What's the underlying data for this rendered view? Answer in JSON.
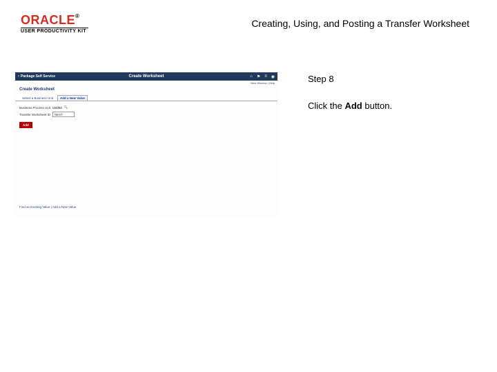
{
  "header": {
    "brand_name": "ORACLE",
    "brand_tm": "®",
    "upk_label": "USER PRODUCTIVITY KIT",
    "doc_title": "Creating, Using, and Posting a Transfer Worksheet"
  },
  "instructions": {
    "step_label": "Step 8",
    "pre_text": "Click the ",
    "bold_text": "Add",
    "post_text": " button."
  },
  "screenshot": {
    "topbar": {
      "back_glyph": "‹",
      "section_title": "Package Self Service",
      "page_title": "Create Worksheet",
      "icons": {
        "home": "⌂",
        "flag": "⚑",
        "menu": "≡",
        "alert": "◉"
      }
    },
    "subbar": "New Window | Help",
    "page_heading": "Create Worksheet",
    "tabs": {
      "tab1": "Select a Business Unit",
      "tab2": "Add a New Value"
    },
    "form": {
      "bu_label": "Business Process Unit",
      "bu_value": "US004",
      "lookup_glyph": "🔍",
      "tw_label": "Transfer Worksheet ID",
      "tw_value": "NEXT"
    },
    "add_button": "Add",
    "footer": "Find an Existing Value | Add a New Value"
  }
}
